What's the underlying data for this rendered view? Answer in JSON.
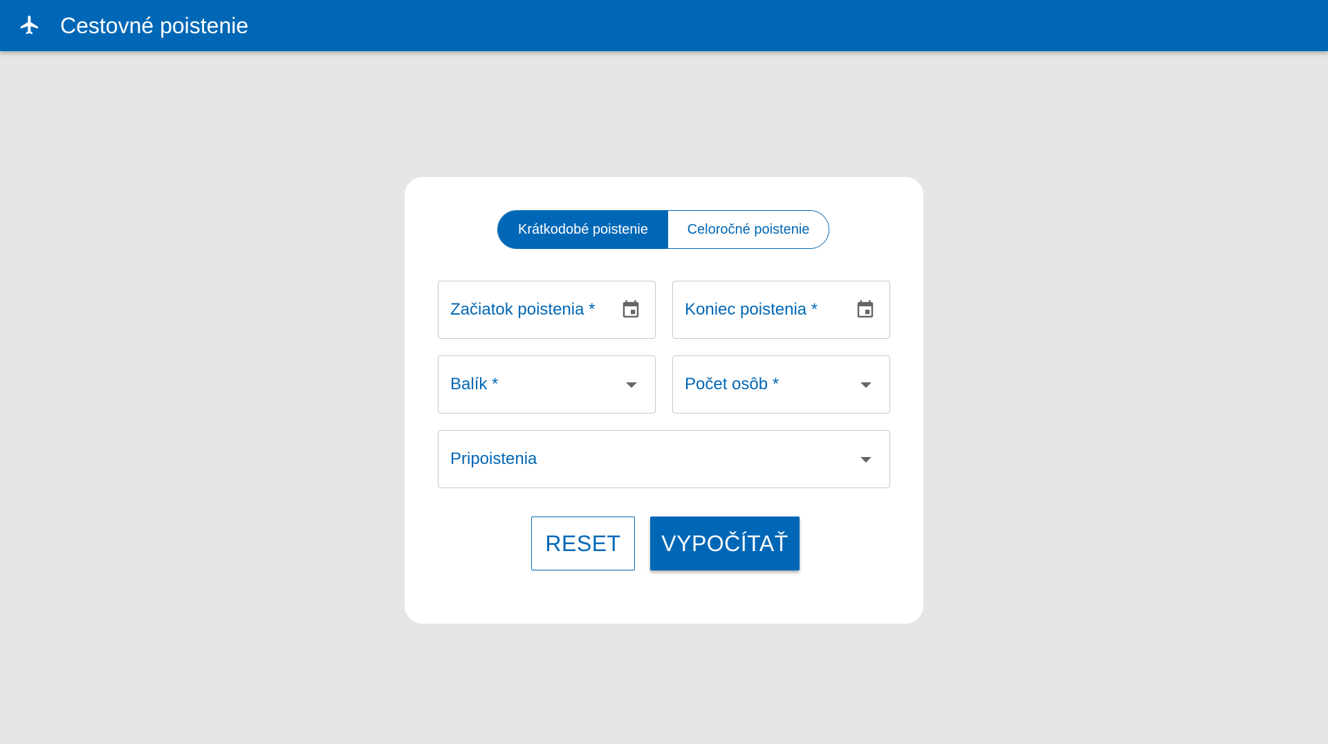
{
  "header": {
    "title": "Cestovné poistenie",
    "icon": "airplane-icon"
  },
  "colors": {
    "primary": "#0067b6",
    "background": "#e5e5e5",
    "card": "#ffffff",
    "field_border": "#c8c8c8",
    "icon_gray": "#666666"
  },
  "toggle": {
    "options": [
      {
        "label": "Krátkodobé poistenie",
        "selected": true
      },
      {
        "label": "Celoročné poistenie",
        "selected": false
      }
    ]
  },
  "form": {
    "start_date": {
      "label": "Začiatok poistenia *",
      "icon": "calendar-icon"
    },
    "end_date": {
      "label": "Koniec poistenia *",
      "icon": "calendar-icon"
    },
    "package": {
      "label": "Balík *",
      "icon": "dropdown-arrow-icon"
    },
    "persons": {
      "label": "Počet osôb *",
      "icon": "dropdown-arrow-icon"
    },
    "addons": {
      "label": "Pripoistenia",
      "icon": "dropdown-arrow-icon"
    }
  },
  "actions": {
    "reset_label": "RESET",
    "calculate_label": "VYPOČÍTAŤ"
  }
}
